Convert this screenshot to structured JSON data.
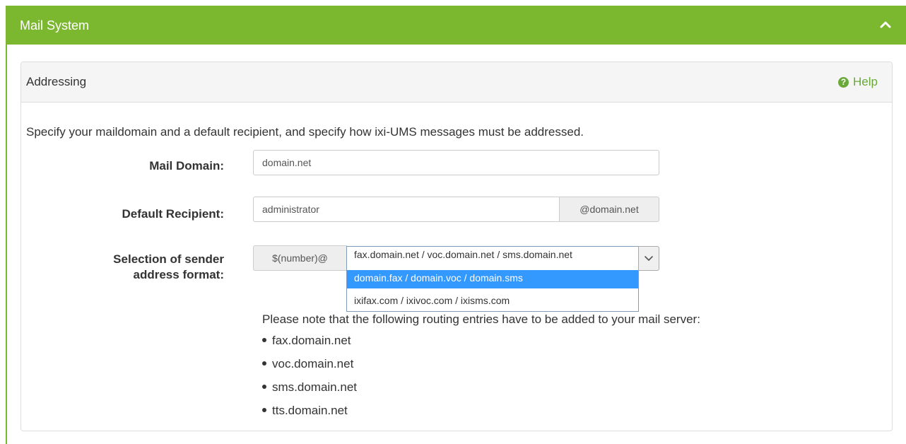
{
  "section": {
    "title": "Mail System",
    "collapse_icon": "chevron-up-icon"
  },
  "panel": {
    "title": "Addressing",
    "help_label": "Help",
    "help_icon": "question-circle-icon",
    "intro": "Specify your maildomain and a default recipient, and specify how ixi-UMS messages must be addressed."
  },
  "form": {
    "mail_domain": {
      "label": "Mail Domain:",
      "value": "domain.net"
    },
    "default_recipient": {
      "label": "Default Recipient:",
      "value": "administrator",
      "suffix": "@domain.net"
    },
    "sender_format": {
      "label_line1": "Selection of sender",
      "label_line2": "address format:",
      "prefix": "$(number)@",
      "options": [
        "fax.domain.net / voc.domain.net / sms.domain.net",
        "domain.fax / domain.voc / domain.sms",
        "ixifax.com / ixivoc.com / ixisms.com"
      ],
      "highlighted_index": 1
    }
  },
  "note": {
    "text": "Please note that the following routing entries have to be added to your mail server:",
    "entries": [
      "fax.domain.net",
      "voc.domain.net",
      "sms.domain.net",
      "tts.domain.net"
    ]
  },
  "colors": {
    "header_green": "#7cb82f",
    "help_green": "#6aa83a",
    "selection_blue": "#3399ff"
  }
}
